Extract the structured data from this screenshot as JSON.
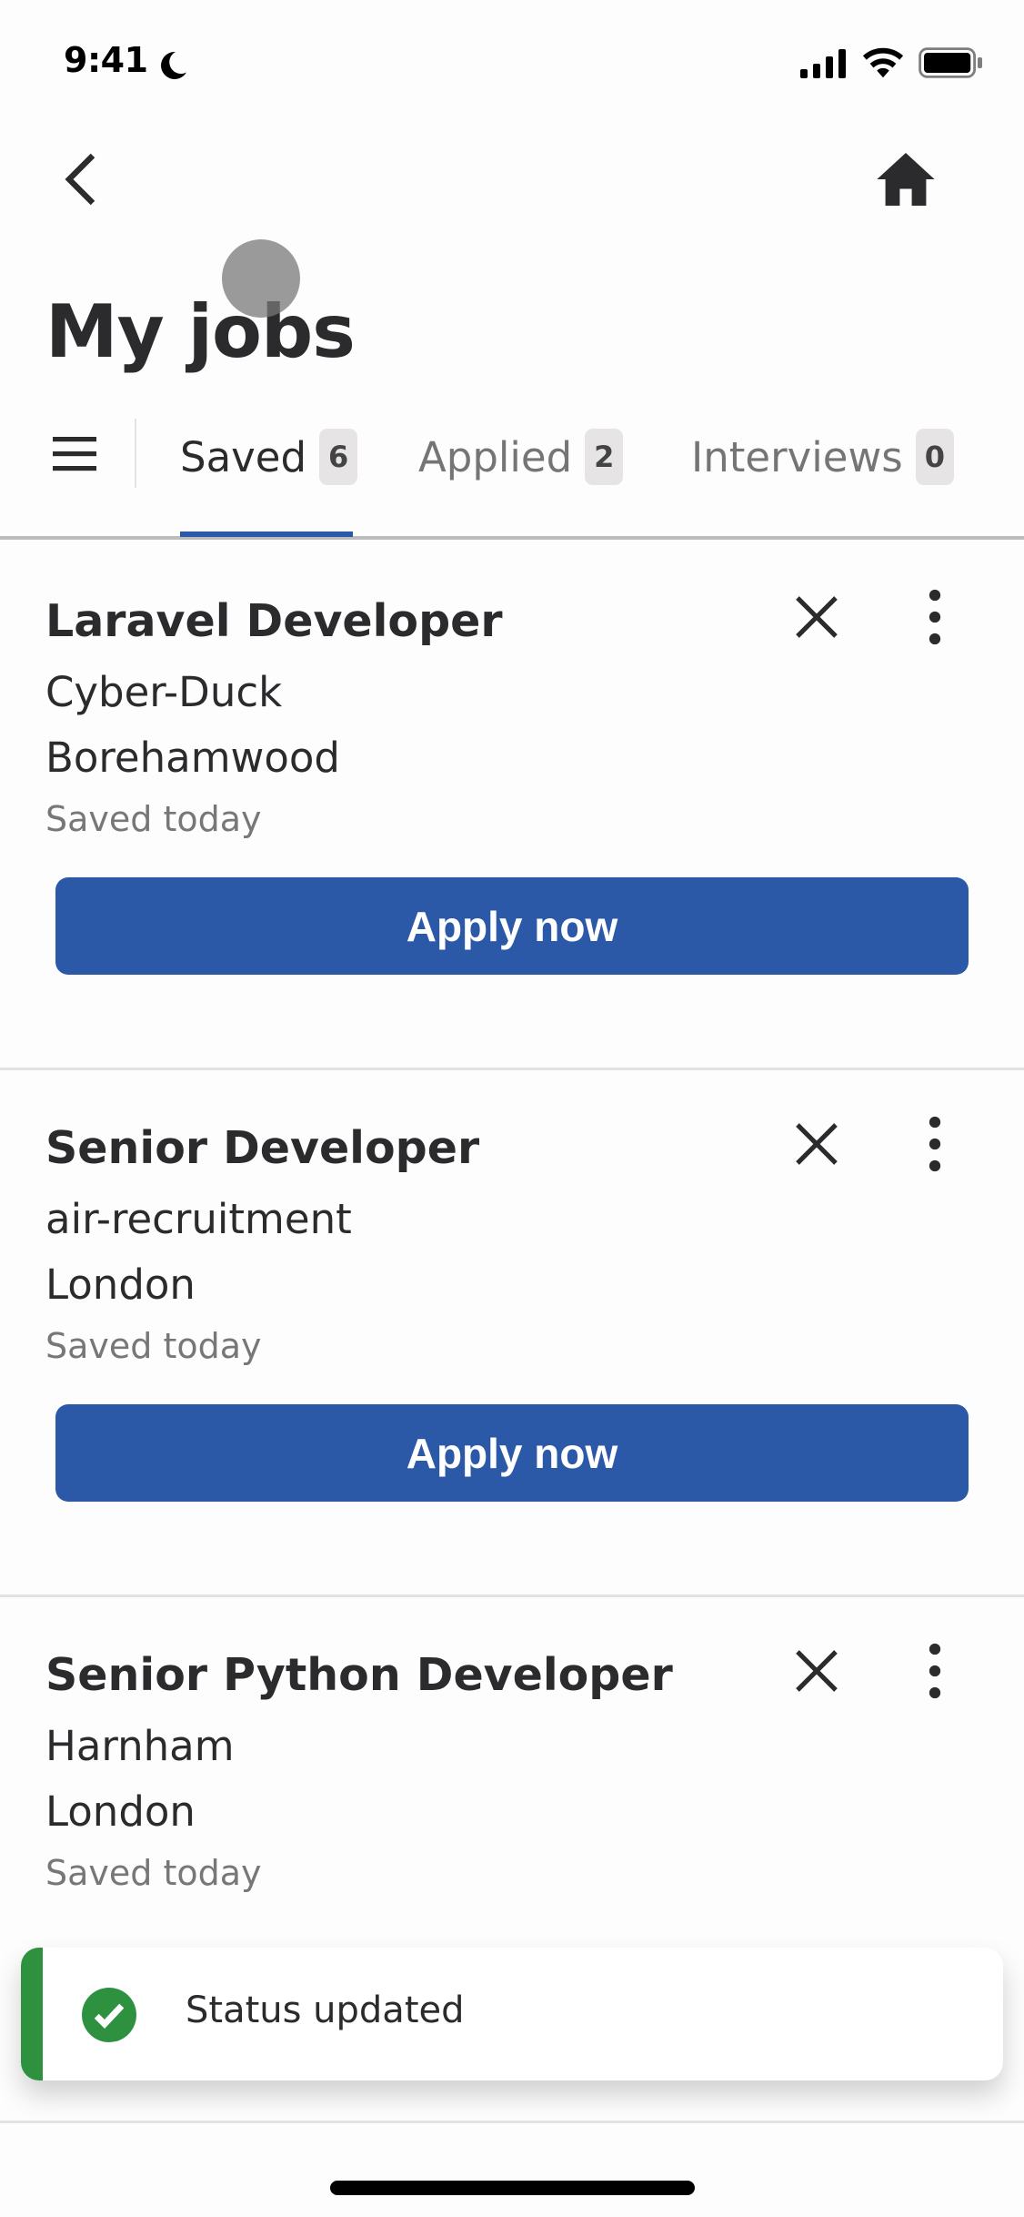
{
  "status_bar": {
    "time": "9:41",
    "moon_icon": "moon-icon",
    "signal_icon": "cellular-signal-icon",
    "wifi_icon": "wifi-icon",
    "battery_icon": "battery-icon"
  },
  "nav": {
    "back_icon": "chevron-left-icon",
    "home_icon": "home-icon"
  },
  "page_title": "My jobs",
  "tabs": [
    {
      "label": "Saved",
      "count": "6",
      "active": true
    },
    {
      "label": "Applied",
      "count": "2",
      "active": false
    },
    {
      "label": "Interviews",
      "count": "0",
      "active": false
    }
  ],
  "jobs": [
    {
      "title": "Laravel Developer",
      "company": "Cyber-Duck",
      "location": "Borehamwood",
      "saved": "Saved today",
      "action": "Apply now"
    },
    {
      "title": "Senior Developer",
      "company": "air-recruitment",
      "location": "London",
      "saved": "Saved today",
      "action": "Apply now"
    },
    {
      "title": "Senior Python Developer",
      "company": "Harnham",
      "location": "London",
      "saved": "Saved today"
    }
  ],
  "toast": {
    "message": "Status updated",
    "icon": "check-circle-icon"
  },
  "colors": {
    "accent": "#2c58a8",
    "success": "#2e9140",
    "badge_bg": "#e6e4e4"
  }
}
